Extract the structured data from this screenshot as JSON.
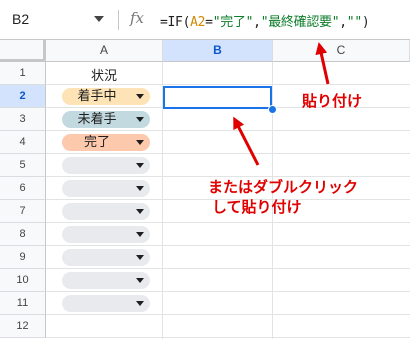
{
  "formula_bar": {
    "cell_ref": "B2",
    "fx": "fx",
    "formula_prefix": "=IF(",
    "formula_ref": "A2",
    "formula_mid1": "=",
    "formula_str1": "\"完了\"",
    "formula_sep1": ",",
    "formula_str2": "\"最終確認要\"",
    "formula_sep2": ",",
    "formula_str3": "\"\"",
    "formula_suffix": ")"
  },
  "columns": [
    "A",
    "B",
    "C"
  ],
  "rows": [
    "1",
    "2",
    "3",
    "4",
    "5",
    "6",
    "7",
    "8",
    "9",
    "10",
    "11",
    "12"
  ],
  "cells": {
    "A1": "状況"
  },
  "chips": [
    {
      "label": "着手中",
      "color": "#fde3b5"
    },
    {
      "label": "未着手",
      "color": "#c2dadf"
    },
    {
      "label": "完了",
      "color": "#fcc9ad"
    },
    {
      "label": "",
      "color": "#e8eaed"
    },
    {
      "label": "",
      "color": "#e8eaed"
    },
    {
      "label": "",
      "color": "#e8eaed"
    },
    {
      "label": "",
      "color": "#e8eaed"
    },
    {
      "label": "",
      "color": "#e8eaed"
    },
    {
      "label": "",
      "color": "#e8eaed"
    },
    {
      "label": "",
      "color": "#e8eaed"
    }
  ],
  "annotations": {
    "paste": "貼り付け",
    "line1": "またはダブルクリック",
    "line2": "して貼り付け"
  },
  "colors": {
    "accent": "#1a73e8",
    "annotation": "#e00000"
  }
}
